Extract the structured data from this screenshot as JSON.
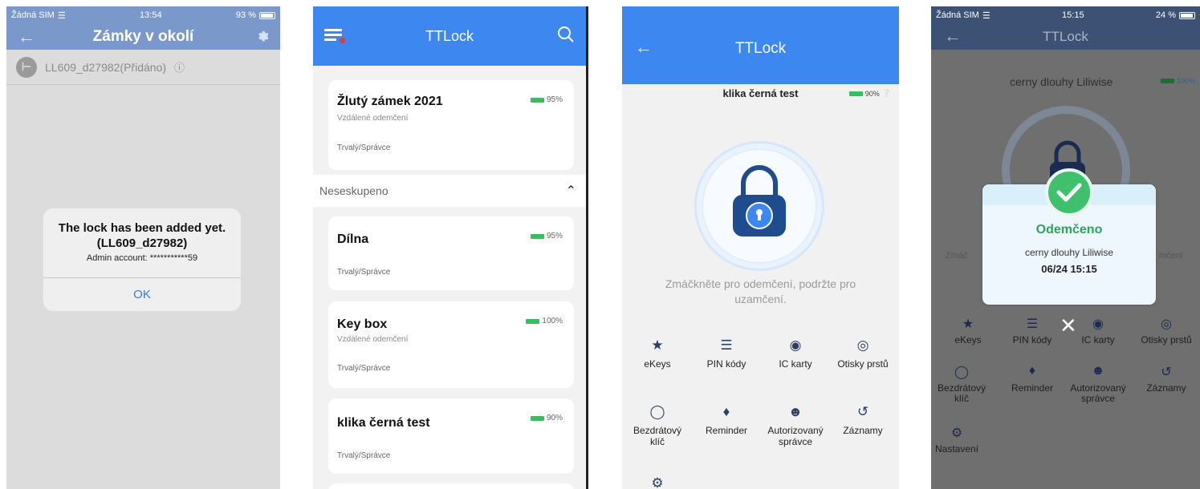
{
  "screen1": {
    "status": {
      "carrier": "Žádná SIM",
      "time": "13:54",
      "battery": "93 %"
    },
    "title": "Zámky v okolí",
    "lock_row": "LL609_d27982(Přidáno)",
    "alert": {
      "title_line1": "The lock has been added yet.",
      "title_line2": "(LL609_d27982)",
      "subtitle": "Admin account: ***********59",
      "ok": "OK"
    }
  },
  "screen2": {
    "title": "TTLock",
    "group_label": "Neseskupeno",
    "cards": [
      {
        "name": "Žlutý zámek 2021",
        "sub": "Vzdálené odemčení",
        "role": "Trvalý/Správce",
        "battery": "95%"
      },
      {
        "name": "Dílna",
        "sub": "",
        "role": "Trvalý/Správce",
        "battery": "95%"
      },
      {
        "name": "Key box",
        "sub": "Vzdálené odemčení",
        "role": "Trvalý/Správce",
        "battery": "100%"
      },
      {
        "name": "klika černá test",
        "sub": "",
        "role": "Trvalý/Správce",
        "battery": "90%"
      }
    ]
  },
  "screen3": {
    "title": "TTLock",
    "lock_name": "klika černá test",
    "battery": "90%",
    "hint": "Zmáčkněte pro odemčení, podržte pro uzamčení.",
    "features": {
      "ekeys": "eKeys",
      "pin": "PIN kódy",
      "ic": "IC karty",
      "fingerprint": "Otisky prstů",
      "wireless_line1": "Bezdrátový",
      "wireless_line2": "klíč",
      "reminder": "Reminder",
      "admin_line1": "Autorizovaný",
      "admin_line2": "správce",
      "records": "Záznamy"
    }
  },
  "screen4": {
    "status": {
      "carrier": "Žádná SIM",
      "time": "15:15",
      "battery": "24 %"
    },
    "title": "TTLock",
    "lock_name": "cerny dlouhy Liliwise",
    "battery": "100%",
    "side_left": "Zmáč",
    "side_right": "mčení",
    "popup": {
      "title": "Odemčeno",
      "name": "cerny dlouhy Liliwise",
      "date": "06/24 15:15"
    },
    "features": {
      "ekeys": "eKeys",
      "pin": "PIN kódy",
      "ic": "IC karty",
      "fingerprint": "Otisky prstů",
      "wireless_line1": "Bezdrátový",
      "wireless_line2": "klíč",
      "reminder": "Reminder",
      "admin_line1": "Autorizovaný",
      "admin_line2": "správce",
      "records": "Záznamy",
      "settings": "Nastavení"
    }
  },
  "colors": {
    "primary": "#3d88f0",
    "battery_green": "#35c05a",
    "success": "#3fc06d"
  }
}
